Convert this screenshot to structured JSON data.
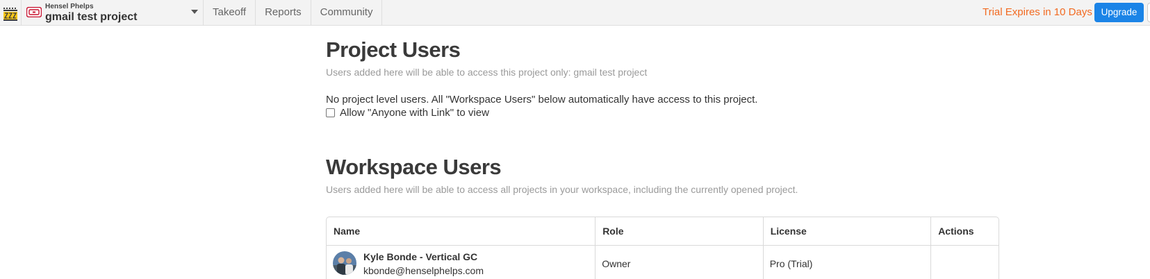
{
  "topbar": {
    "app_logo_icon": "castle-logo-icon",
    "company_logo_icon": "hensel-phelps-logo-icon",
    "company_name": "Hensel Phelps",
    "project_name": "gmail test project",
    "nav": [
      {
        "label": "Takeoff"
      },
      {
        "label": "Reports"
      },
      {
        "label": "Community"
      }
    ],
    "trial_text": "Trial Expires in 10 Days",
    "upgrade_label": "Upgrade"
  },
  "project_users": {
    "title": "Project Users",
    "subtitle": "Users added here will be able to access this project only:  gmail test project",
    "empty_text": "No project level users.  All \"Workspace Users\" below automatically have access to this project.",
    "anyone_with_link_label": "Allow \"Anyone with Link\" to view",
    "anyone_with_link_checked": false
  },
  "workspace_users": {
    "title": "Workspace Users",
    "subtitle": "Users added here will be able to access all projects in your workspace, including the currently opened project.",
    "columns": [
      "Name",
      "Role",
      "License",
      "Actions"
    ],
    "rows": [
      {
        "name": "Kyle Bonde - Vertical GC",
        "email": "kbonde@henselphelps.com",
        "role": "Owner",
        "license": "Pro (Trial)",
        "actions": ""
      }
    ]
  },
  "colors": {
    "accent": "#1b84e7",
    "trial": "#f26a21",
    "brand_red": "#c8102e"
  }
}
